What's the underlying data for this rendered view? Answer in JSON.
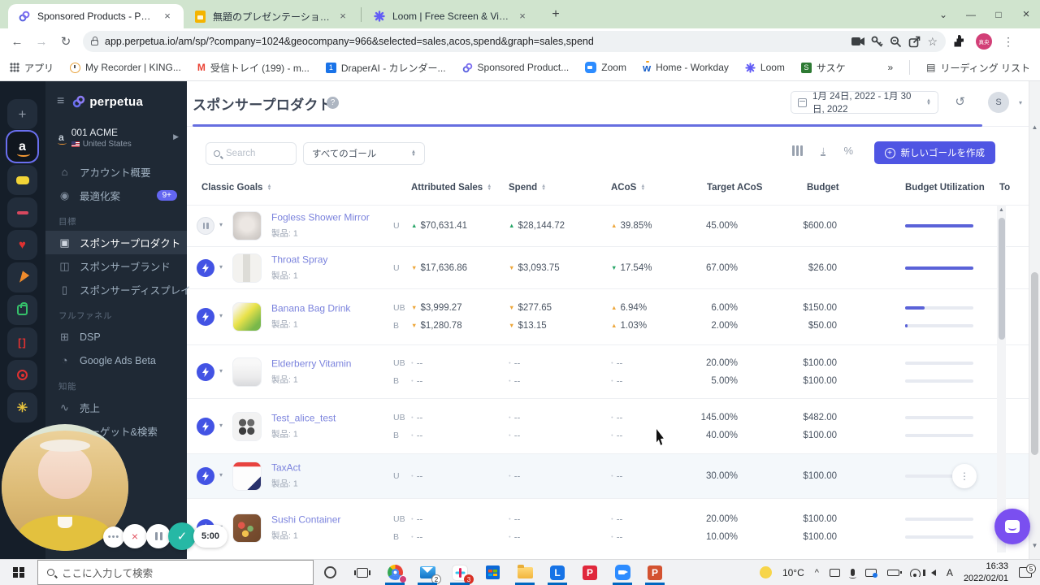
{
  "icons": {
    "close": "×",
    "new_tab": "+",
    "window_menu": "⌄",
    "minimize": "—",
    "maximize": "□",
    "back": "←",
    "forward": "→",
    "reload": "↻",
    "more": "⋮",
    "overflow": "»",
    "caret_down": "▾",
    "caret_right": "▶",
    "menu": "≡",
    "star": "☆",
    "home": "⌂",
    "bulb": "◉",
    "sp": "▣",
    "sb": "◫",
    "sd": "▯",
    "dsp": "⊞",
    "gads": "◔",
    "chart": "∿",
    "key": "⌖",
    "pct": "%",
    "help": "?",
    "history": "↺",
    "reading_list": "▤",
    "amazon": "a",
    "up": "▲",
    "down": "▼",
    "check": "✓",
    "gmail": "M",
    "calendar": "1",
    "workday": "w",
    "sasuke": "S",
    "loom_l": "L",
    "redp": "P",
    "ppt": "P"
  },
  "browser": {
    "tabs": [
      {
        "title": "Sponsored Products - Perpetua"
      },
      {
        "title": "無題のプレゼンテーション - Google ス"
      },
      {
        "title": "Loom | Free Screen & Video Rec"
      }
    ],
    "url": "app.perpetua.io/am/sp/?company=1024&geocompany=966&selected=sales,acos,spend&graph=sales,spend",
    "profile": "真央",
    "bookmarks": {
      "apps": "アプリ",
      "items": [
        "My Recorder | KING...",
        "受信トレイ (199) - m...",
        "DraperAI - カレンダー...",
        "Sponsored Product...",
        "Zoom",
        "Home - Workday",
        "Loom",
        "サスケ"
      ],
      "reading_list": "リーディング リスト"
    }
  },
  "sidebar": {
    "brand": "perpetua",
    "account_name": "001 ACME",
    "account_region": "United States",
    "overview": "アカウント概要",
    "optimize": "最適化案",
    "optimize_badge": "9+",
    "sec_goals": "目標",
    "sp": "スポンサープロダクト",
    "sb": "スポンサーブランド",
    "sd": "スポンサーディスプレイ",
    "sec_funnel": "フルファネル",
    "dsp": "DSP",
    "gads": "Google Ads Beta",
    "sec_intel": "知能",
    "sales": "売上",
    "target": "ターゲット&検索"
  },
  "page": {
    "title": "スポンサープロダクト",
    "date_range": "1月 24日, 2022 - 1月 30日, 2022",
    "avatar": "S",
    "search_placeholder": "Search",
    "goal_filter": "すべてのゴール",
    "new_goal": "新しいゴールを作成"
  },
  "table": {
    "headers": {
      "goals": "Classic Goals",
      "sales": "Attributed Sales",
      "spend": "Spend",
      "acos": "ACoS",
      "target": "Target ACoS",
      "budget": "Budget",
      "utilization": "Budget Utilization",
      "to": "To"
    },
    "rows": [
      {
        "name": "Fogless Shower Mirror",
        "products": "製品: 1",
        "thumb": "mirror",
        "lines": [
          {
            "badge": "U",
            "sales": {
              "d": "up",
              "c": "green",
              "t": "$70,631.41"
            },
            "spend": {
              "d": "up",
              "c": "green",
              "t": "$28,144.72"
            },
            "acos": {
              "d": "up",
              "c": "orange",
              "t": "39.85%"
            },
            "target": "45.00%",
            "budget": "$600.00",
            "bar": {
              "w": "100%",
              "c": "purple"
            }
          }
        ]
      },
      {
        "name": "Throat Spray",
        "products": "製品: 1",
        "thumb": "spray",
        "lines": [
          {
            "badge": "U",
            "sales": {
              "d": "down",
              "c": "orange",
              "t": "$17,636.86"
            },
            "spend": {
              "d": "down",
              "c": "orange",
              "t": "$3,093.75"
            },
            "acos": {
              "d": "down",
              "c": "green",
              "t": "17.54%"
            },
            "target": "67.00%",
            "budget": "$26.00",
            "bar": {
              "w": "100%",
              "c": "purple"
            }
          }
        ]
      },
      {
        "name": "Banana Bag Drink",
        "products": "製品: 1",
        "thumb": "banana",
        "lines": [
          {
            "badge": "UB",
            "sales": {
              "d": "down",
              "c": "orange",
              "t": "$3,999.27"
            },
            "spend": {
              "d": "down",
              "c": "orange",
              "t": "$277.65"
            },
            "acos": {
              "d": "up",
              "c": "orange",
              "t": "6.94%"
            },
            "target": "6.00%",
            "budget": "$150.00",
            "bar": {
              "w": "28%",
              "c": "purple"
            }
          },
          {
            "badge": "B",
            "sales": {
              "d": "down",
              "c": "orange",
              "t": "$1,280.78"
            },
            "spend": {
              "d": "down",
              "c": "orange",
              "t": "$13.15"
            },
            "acos": {
              "d": "up",
              "c": "orange",
              "t": "1.03%"
            },
            "target": "2.00%",
            "budget": "$50.00",
            "bar": {
              "w": "3%",
              "c": "purple"
            }
          }
        ]
      },
      {
        "name": "Elderberry Vitamin",
        "products": "製品: 1",
        "thumb": "vitamin",
        "lines": [
          {
            "badge": "UB",
            "sales": {
              "d": "none",
              "c": "gray",
              "t": "--"
            },
            "spend": {
              "d": "none",
              "c": "gray",
              "t": "--"
            },
            "acos": {
              "d": "none",
              "c": "gray",
              "t": "--"
            },
            "target": "20.00%",
            "budget": "$100.00",
            "bar": {
              "w": "0%",
              "c": "gray"
            }
          },
          {
            "badge": "B",
            "sales": {
              "d": "none",
              "c": "gray",
              "t": "--"
            },
            "spend": {
              "d": "none",
              "c": "gray",
              "t": "--"
            },
            "acos": {
              "d": "none",
              "c": "gray",
              "t": "--"
            },
            "target": "5.00%",
            "budget": "$100.00",
            "bar": {
              "w": "0%",
              "c": "gray"
            }
          }
        ]
      },
      {
        "name": "Test_alice_test",
        "products": "製品: 1",
        "thumb": "alice",
        "lines": [
          {
            "badge": "UB",
            "sales": {
              "d": "none",
              "c": "gray",
              "t": "--"
            },
            "spend": {
              "d": "none",
              "c": "gray",
              "t": "--"
            },
            "acos": {
              "d": "none",
              "c": "gray",
              "t": "--"
            },
            "target": "145.00%",
            "budget": "$482.00",
            "bar": {
              "w": "0%",
              "c": "gray"
            }
          },
          {
            "badge": "B",
            "sales": {
              "d": "none",
              "c": "gray",
              "t": "--"
            },
            "spend": {
              "d": "none",
              "c": "gray",
              "t": "--"
            },
            "acos": {
              "d": "none",
              "c": "gray",
              "t": "--"
            },
            "target": "40.00%",
            "budget": "$100.00",
            "bar": {
              "w": "0%",
              "c": "gray"
            }
          }
        ]
      },
      {
        "name": "TaxAct",
        "products": "製品: 1",
        "thumb": "taxact",
        "lines": [
          {
            "badge": "U",
            "sales": {
              "d": "none",
              "c": "gray",
              "t": "--"
            },
            "spend": {
              "d": "none",
              "c": "gray",
              "t": "--"
            },
            "acos": {
              "d": "none",
              "c": "gray",
              "t": "--"
            },
            "target": "30.00%",
            "budget": "$100.00",
            "bar": {
              "w": "0%",
              "c": "gray"
            }
          }
        ]
      },
      {
        "name": "Sushi Container",
        "products": "製品: 1",
        "thumb": "sushi",
        "lines": [
          {
            "badge": "UB",
            "sales": {
              "d": "none",
              "c": "gray",
              "t": "--"
            },
            "spend": {
              "d": "none",
              "c": "gray",
              "t": "--"
            },
            "acos": {
              "d": "none",
              "c": "gray",
              "t": "--"
            },
            "target": "20.00%",
            "budget": "$100.00",
            "bar": {
              "w": "0%",
              "c": "gray"
            }
          },
          {
            "badge": "B",
            "sales": {
              "d": "none",
              "c": "gray",
              "t": "--"
            },
            "spend": {
              "d": "none",
              "c": "gray",
              "t": "--"
            },
            "acos": {
              "d": "none",
              "c": "gray",
              "t": "--"
            },
            "target": "10.00%",
            "budget": "$100.00",
            "bar": {
              "w": "0%",
              "c": "gray"
            }
          }
        ]
      }
    ]
  },
  "overlay": {
    "timer": "5:00"
  },
  "taskbar": {
    "search_placeholder": "ここに入力して検索",
    "temp": "10°C",
    "ime": "A",
    "time": "16:33",
    "date": "2022/02/01",
    "mail_badge": "2",
    "slack_badge": "3",
    "notif_badge": "5",
    "tray_chevron": "^"
  }
}
